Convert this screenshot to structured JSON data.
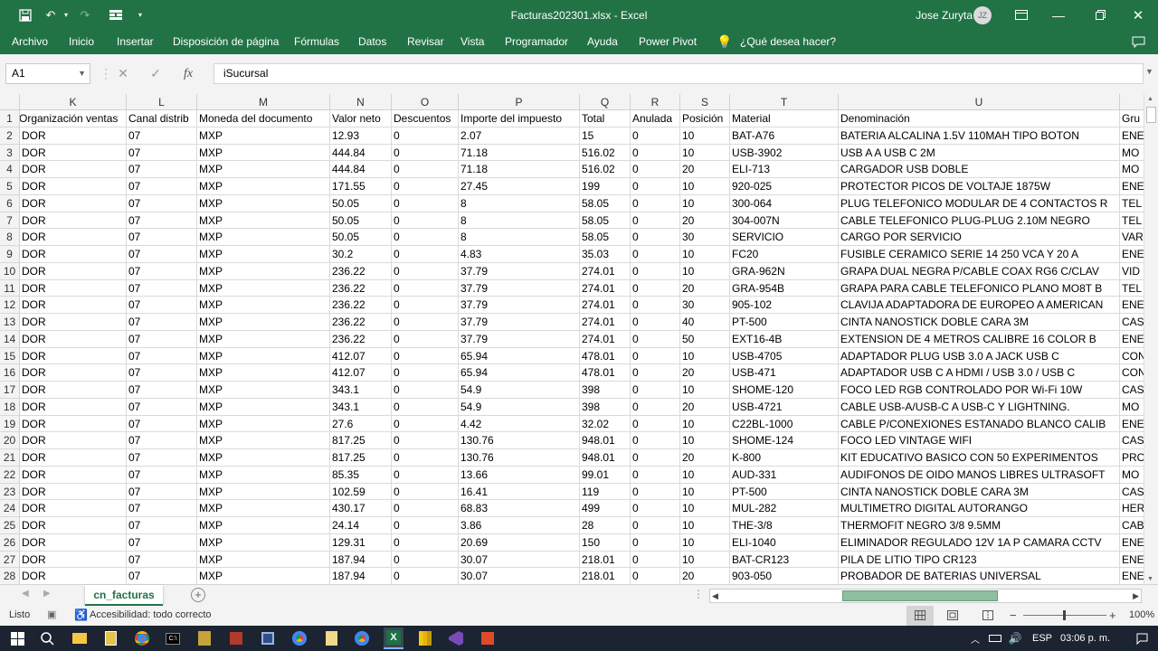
{
  "window": {
    "title": "Facturas202301.xlsx  -  Excel",
    "user": "Jose Zuryta",
    "user_initials": "JZ"
  },
  "ribbon": {
    "tabs": [
      "Archivo",
      "Inicio",
      "Insertar",
      "Disposición de página",
      "Fórmulas",
      "Datos",
      "Revisar",
      "Vista",
      "Programador",
      "Ayuda",
      "Power Pivot"
    ],
    "tell_me": "¿Qué desea hacer?"
  },
  "formula_bar": {
    "name_box": "A1",
    "cancel": "✕",
    "enter": "✓",
    "fx": "fx",
    "content": "iSucursal"
  },
  "columns": [
    {
      "letter": "K",
      "header": "Organización ventas"
    },
    {
      "letter": "L",
      "header": "Canal distrib"
    },
    {
      "letter": "M",
      "header": "Moneda del documento"
    },
    {
      "letter": "N",
      "header": "Valor neto"
    },
    {
      "letter": "O",
      "header": "Descuentos"
    },
    {
      "letter": "P",
      "header": "Importe del impuesto"
    },
    {
      "letter": "Q",
      "header": "Total"
    },
    {
      "letter": "R",
      "header": "Anulada"
    },
    {
      "letter": "S",
      "header": "Posición"
    },
    {
      "letter": "T",
      "header": "Material"
    },
    {
      "letter": "U",
      "header": "Denominación"
    },
    {
      "letter": "",
      "header": "Gru"
    }
  ],
  "rows": [
    [
      "DOR",
      "07",
      "MXP",
      "12.93",
      "0",
      "2.07",
      "15",
      "0",
      "10",
      "BAT-A76",
      "BATERIA ALCALINA 1.5V 110MAH TIPO BOTON",
      "ENE"
    ],
    [
      "DOR",
      "07",
      "MXP",
      "444.84",
      "0",
      "71.18",
      "516.02",
      "0",
      "10",
      "USB-3902",
      "USB A A USB C 2M",
      "MO"
    ],
    [
      "DOR",
      "07",
      "MXP",
      "444.84",
      "0",
      "71.18",
      "516.02",
      "0",
      "20",
      "ELI-713",
      "CARGADOR USB DOBLE",
      "MO"
    ],
    [
      "DOR",
      "07",
      "MXP",
      "171.55",
      "0",
      "27.45",
      "199",
      "0",
      "10",
      "920-025",
      "PROTECTOR PICOS DE VOLTAJE 1875W",
      "ENE"
    ],
    [
      "DOR",
      "07",
      "MXP",
      "50.05",
      "0",
      "8",
      "58.05",
      "0",
      "10",
      "300-064",
      "PLUG TELEFONICO MODULAR DE 4 CONTACTOS R",
      "TEL"
    ],
    [
      "DOR",
      "07",
      "MXP",
      "50.05",
      "0",
      "8",
      "58.05",
      "0",
      "20",
      "304-007N",
      "CABLE TELEFONICO PLUG-PLUG 2.10M NEGRO",
      "TEL"
    ],
    [
      "DOR",
      "07",
      "MXP",
      "50.05",
      "0",
      "8",
      "58.05",
      "0",
      "30",
      "SERVICIO",
      "CARGO POR SERVICIO",
      "VAR"
    ],
    [
      "DOR",
      "07",
      "MXP",
      "30.2",
      "0",
      "4.83",
      "35.03",
      "0",
      "10",
      "FC20",
      "FUSIBLE CERAMICO SERIE 14 250 VCA Y 20 A",
      "ENE"
    ],
    [
      "DOR",
      "07",
      "MXP",
      "236.22",
      "0",
      "37.79",
      "274.01",
      "0",
      "10",
      "GRA-962N",
      "GRAPA DUAL NEGRA P/CABLE COAX RG6 C/CLAV",
      "VID"
    ],
    [
      "DOR",
      "07",
      "MXP",
      "236.22",
      "0",
      "37.79",
      "274.01",
      "0",
      "20",
      "GRA-954B",
      "GRAPA PARA CABLE TELEFONICO PLANO MO8T B",
      "TEL"
    ],
    [
      "DOR",
      "07",
      "MXP",
      "236.22",
      "0",
      "37.79",
      "274.01",
      "0",
      "30",
      "905-102",
      "CLAVIJA ADAPTADORA DE EUROPEO A AMERICAN",
      "ENE"
    ],
    [
      "DOR",
      "07",
      "MXP",
      "236.22",
      "0",
      "37.79",
      "274.01",
      "0",
      "40",
      "PT-500",
      "CINTA NANOSTICK DOBLE CARA 3M",
      "CAS"
    ],
    [
      "DOR",
      "07",
      "MXP",
      "236.22",
      "0",
      "37.79",
      "274.01",
      "0",
      "50",
      "EXT16-4B",
      "EXTENSION DE 4 METROS CALIBRE 16 COLOR B",
      "ENE"
    ],
    [
      "DOR",
      "07",
      "MXP",
      "412.07",
      "0",
      "65.94",
      "478.01",
      "0",
      "10",
      "USB-4705",
      "ADAPTADOR PLUG USB 3.0 A JACK USB C",
      "CON"
    ],
    [
      "DOR",
      "07",
      "MXP",
      "412.07",
      "0",
      "65.94",
      "478.01",
      "0",
      "20",
      "USB-471",
      "ADAPTADOR USB C A HDMI / USB 3.0 / USB C",
      "CON"
    ],
    [
      "DOR",
      "07",
      "MXP",
      "343.1",
      "0",
      "54.9",
      "398",
      "0",
      "10",
      "SHOME-120",
      "FOCO LED RGB CONTROLADO POR Wi-Fi 10W",
      "CAS"
    ],
    [
      "DOR",
      "07",
      "MXP",
      "343.1",
      "0",
      "54.9",
      "398",
      "0",
      "20",
      "USB-4721",
      "CABLE USB-A/USB-C A USB-C Y LIGHTNING.",
      "MO"
    ],
    [
      "DOR",
      "07",
      "MXP",
      "27.6",
      "0",
      "4.42",
      "32.02",
      "0",
      "10",
      "C22BL-1000",
      "CABLE P/CONEXIONES ESTANADO BLANCO CALIB",
      "ENE"
    ],
    [
      "DOR",
      "07",
      "MXP",
      "817.25",
      "0",
      "130.76",
      "948.01",
      "0",
      "10",
      "SHOME-124",
      "FOCO LED VINTAGE WIFI",
      "CAS"
    ],
    [
      "DOR",
      "07",
      "MXP",
      "817.25",
      "0",
      "130.76",
      "948.01",
      "0",
      "20",
      "K-800",
      "KIT EDUCATIVO BASICO CON 50 EXPERIMENTOS",
      "PRO"
    ],
    [
      "DOR",
      "07",
      "MXP",
      "85.35",
      "0",
      "13.66",
      "99.01",
      "0",
      "10",
      "AUD-331",
      "AUDIFONOS DE OIDO MANOS LIBRES ULTRASOFT",
      "MO"
    ],
    [
      "DOR",
      "07",
      "MXP",
      "102.59",
      "0",
      "16.41",
      "119",
      "0",
      "10",
      "PT-500",
      "CINTA NANOSTICK DOBLE CARA 3M",
      "CAS"
    ],
    [
      "DOR",
      "07",
      "MXP",
      "430.17",
      "0",
      "68.83",
      "499",
      "0",
      "10",
      "MUL-282",
      "MULTIMETRO DIGITAL AUTORANGO",
      "HER"
    ],
    [
      "DOR",
      "07",
      "MXP",
      "24.14",
      "0",
      "3.86",
      "28",
      "0",
      "10",
      "THE-3/8",
      "THERMOFIT NEGRO 3/8 9.5MM",
      "CAB"
    ],
    [
      "DOR",
      "07",
      "MXP",
      "129.31",
      "0",
      "20.69",
      "150",
      "0",
      "10",
      "ELI-1040",
      "ELIMINADOR REGULADO 12V 1A P CAMARA CCTV",
      "ENE"
    ],
    [
      "DOR",
      "07",
      "MXP",
      "187.94",
      "0",
      "30.07",
      "218.01",
      "0",
      "10",
      "BAT-CR123",
      "PILA DE LITIO TIPO CR123",
      "ENE"
    ],
    [
      "DOR",
      "07",
      "MXP",
      "187.94",
      "0",
      "30.07",
      "218.01",
      "0",
      "20",
      "903-050",
      "PROBADOR DE BATERIAS UNIVERSAL",
      "ENE"
    ]
  ],
  "sheet": {
    "tab": "cn_facturas",
    "add": "+"
  },
  "status": {
    "ready": "Listo",
    "accessibility": "Accesibilidad: todo correcto",
    "zoom": "100%"
  },
  "taskbar": {
    "lang": "ESP",
    "time": "03:06 p. m."
  }
}
